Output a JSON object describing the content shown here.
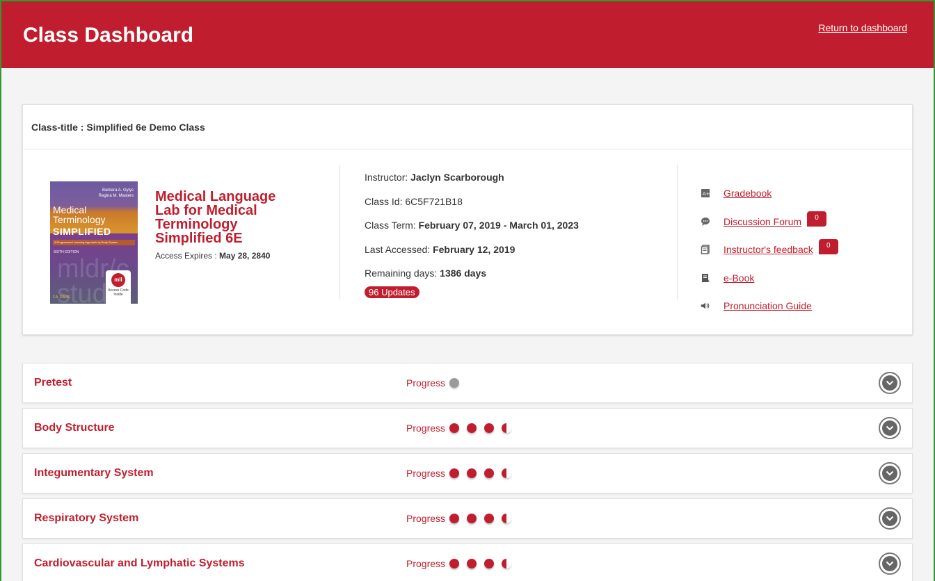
{
  "header": {
    "title": "Class Dashboard",
    "return_link": "Return to dashboard"
  },
  "class_card": {
    "title": "Class-title : Simplified 6e Demo Class",
    "book": {
      "cover": {
        "authors": [
          "Barbara A. Gylys",
          "Regina M. Masters"
        ],
        "title_top": "Medical",
        "title_mid": "Terminology",
        "title_bold": "SIMPLIFIED",
        "subtitle": "A Programmed Learning Approach by Body System",
        "edition": "SIXTH EDITION",
        "badge_logo": "mll",
        "badge_text": "Access Code Inside",
        "publisher": "F.A. DAVIS"
      },
      "name": "Medical Language Lab for Medical Terminology Simplified 6E",
      "expires_label": "Access Expires : ",
      "expires_value": "May 28, 2840"
    },
    "info": {
      "instructor_label": "Instructor: ",
      "instructor_value": "Jaclyn Scarborough",
      "class_id_label": "Class Id: ",
      "class_id_value": "6C5F721B18",
      "term_label": "Class Term: ",
      "term_value": "February 07, 2019 - March 01, 2023",
      "last_accessed_label": "Last Accessed: ",
      "last_accessed_value": "February 12, 2019",
      "remaining_label": "Remaining days: ",
      "remaining_value": "1386 days",
      "updates_badge": "96 Updates"
    },
    "links": [
      {
        "label": "Gradebook",
        "icon": "gradebook-icon"
      },
      {
        "label": "Discussion Forum",
        "icon": "chat-icon",
        "count": "0"
      },
      {
        "label": "Instructor's feedback",
        "icon": "feedback-icon",
        "count": "0"
      },
      {
        "label": "e-Book",
        "icon": "book-icon"
      },
      {
        "label": "Pronunciation Guide",
        "icon": "speaker-icon"
      }
    ]
  },
  "modules": [
    {
      "name": "Pretest",
      "progress_label": "Progress",
      "progress": [
        "gray"
      ]
    },
    {
      "name": "Body Structure",
      "progress_label": "Progress",
      "progress": [
        "full",
        "full",
        "full",
        "half"
      ]
    },
    {
      "name": "Integumentary System",
      "progress_label": "Progress",
      "progress": [
        "full",
        "full",
        "full",
        "half"
      ]
    },
    {
      "name": "Respiratory System",
      "progress_label": "Progress",
      "progress": [
        "full",
        "full",
        "full",
        "half"
      ]
    },
    {
      "name": "Cardiovascular and Lymphatic Systems",
      "progress_label": "Progress",
      "progress": [
        "full",
        "full",
        "full",
        "half"
      ]
    }
  ],
  "colors": {
    "brand": "#c01e2e",
    "frame": "#2f9a2f"
  }
}
